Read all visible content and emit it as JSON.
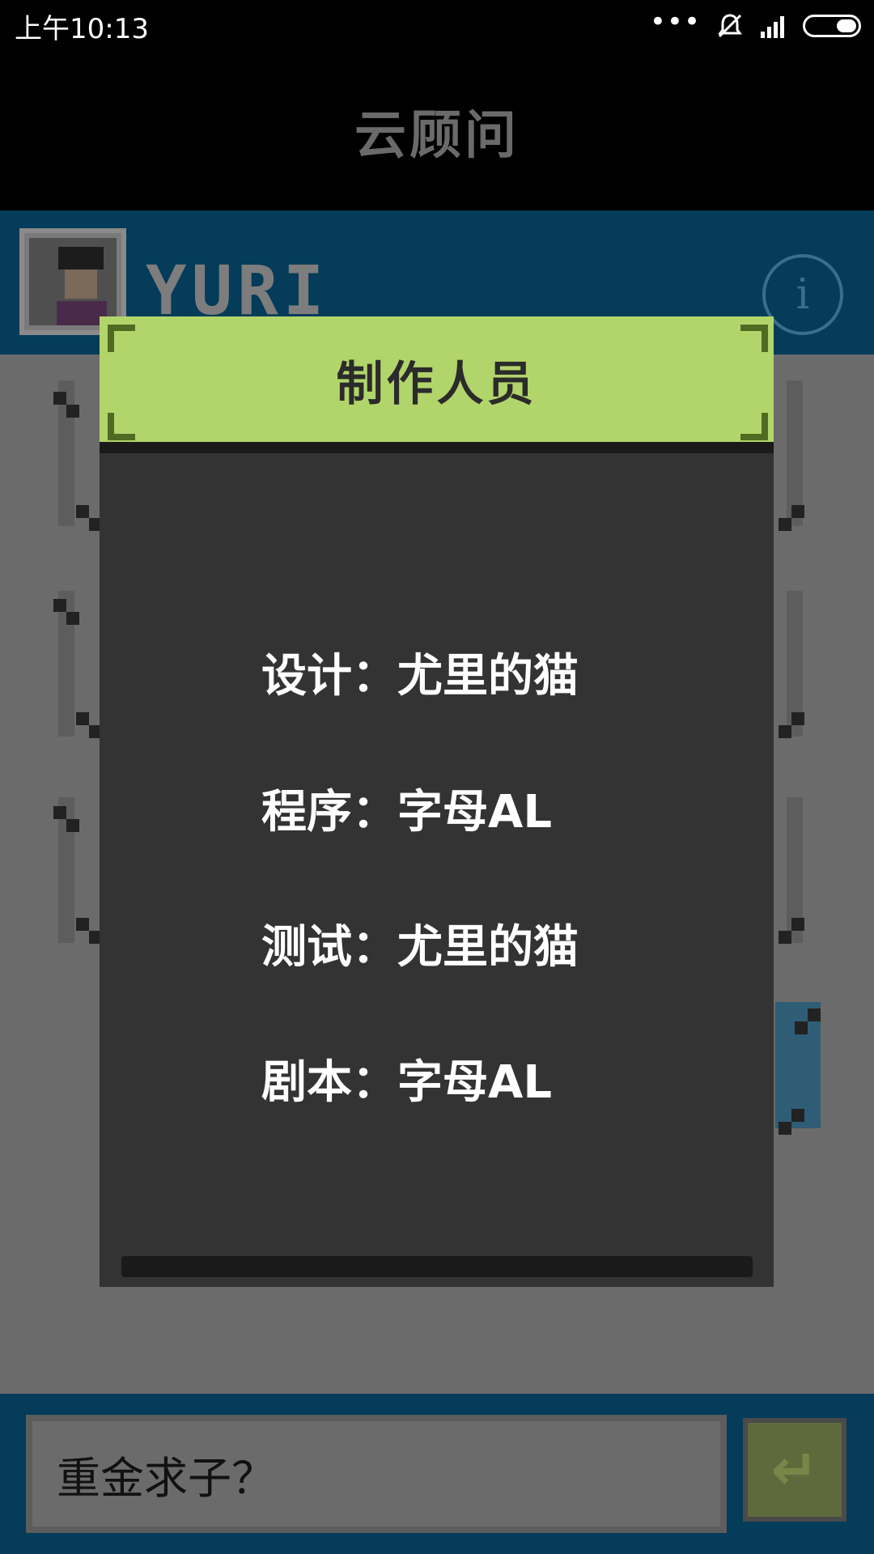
{
  "status_bar": {
    "time": "上午10:13",
    "dots": "•••"
  },
  "app_title": "云顾问",
  "profile": {
    "name": "YURI",
    "info_icon": "i"
  },
  "dialog": {
    "title": "制作人员",
    "credits": [
      {
        "text": "设计：尤里的猫"
      },
      {
        "text": "程序：字母AL"
      },
      {
        "text": "测试：尤里的猫"
      },
      {
        "text": "剧本：字母AL"
      }
    ]
  },
  "input": {
    "value": "重金求子？"
  },
  "send_button": {
    "glyph": "↵"
  },
  "colors": {
    "dialog_header": "#b2d56b",
    "dialog_body": "#333333",
    "header_strip": "#043c5a"
  }
}
